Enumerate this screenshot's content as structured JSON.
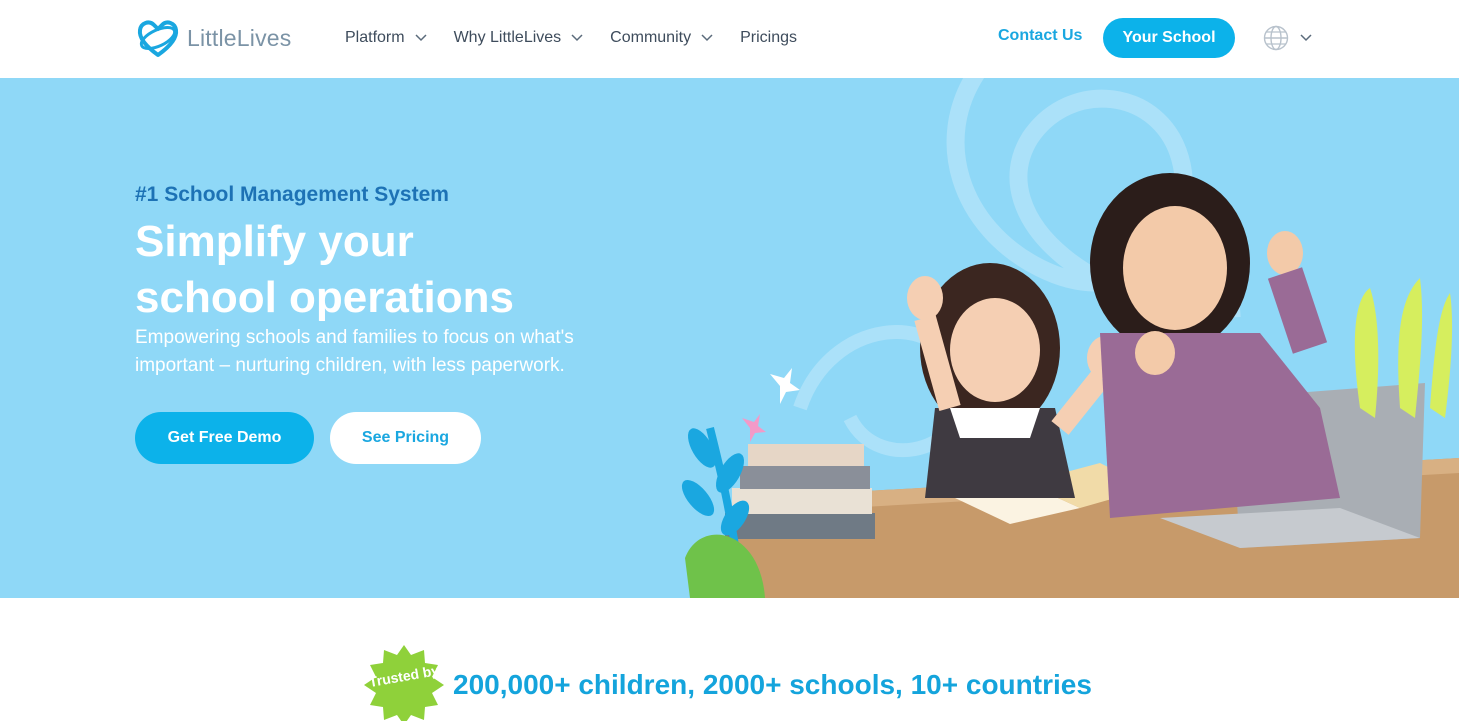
{
  "brand": {
    "name": "LittleLives",
    "color": "#0cb2ea"
  },
  "nav": {
    "items": [
      {
        "label": "Platform",
        "has_dropdown": true
      },
      {
        "label": "Why LittleLives",
        "has_dropdown": true
      },
      {
        "label": "Community",
        "has_dropdown": true
      },
      {
        "label": "Pricings",
        "has_dropdown": false
      }
    ],
    "contact": "Contact Us",
    "your_school": "Your School",
    "language_icon": "globe-icon"
  },
  "hero": {
    "tag": "#1 School Management System",
    "headline_line1": "Simplify your",
    "headline_line2": "school operations",
    "subtext": "Empowering schools and families to focus on what's important – nurturing children, with less paperwork.",
    "primary_button": "Get Free Demo",
    "secondary_button": "See Pricing",
    "background_color": "#8fd8f7"
  },
  "trust": {
    "badge": "Trusted by",
    "badge_color": "#8fd13a",
    "line": "200,000+ children, 2000+ schools, 10+ countries"
  }
}
